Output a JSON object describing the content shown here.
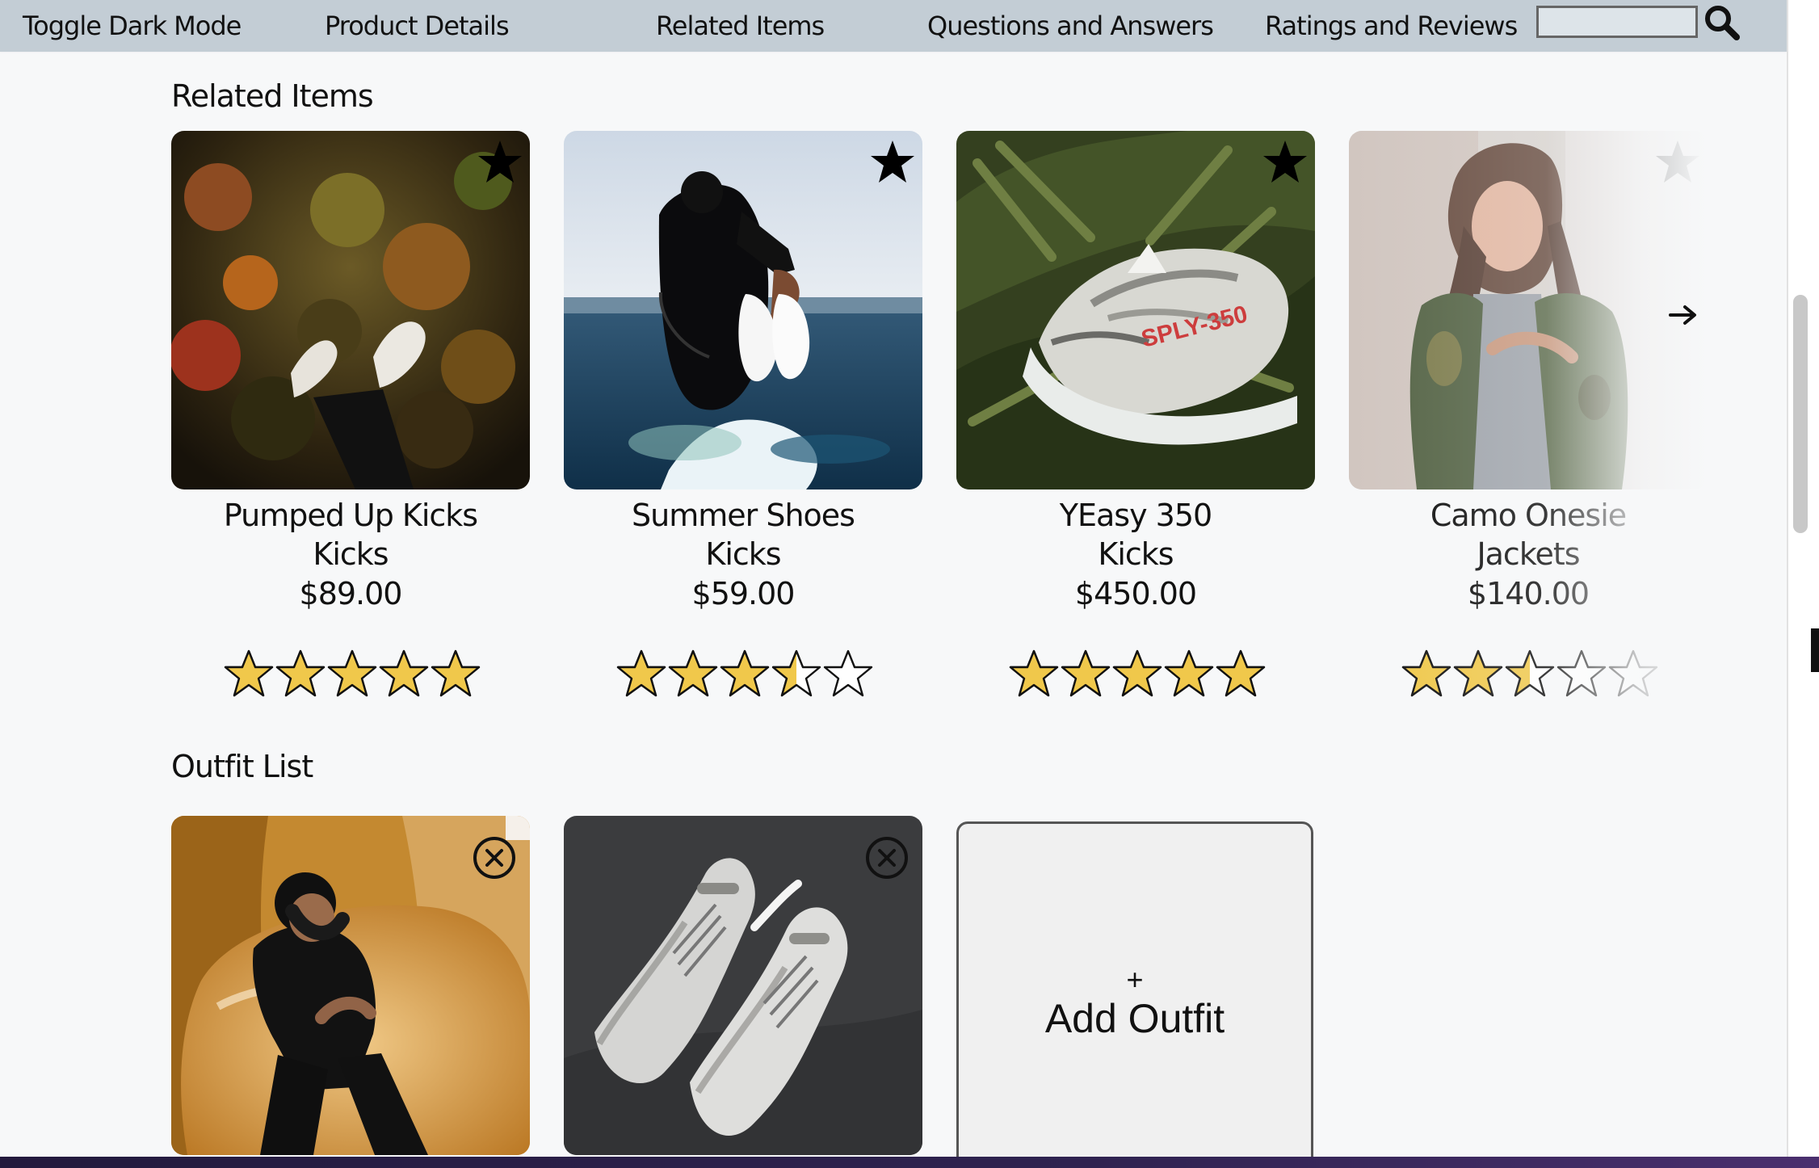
{
  "colors": {
    "navbar_bg": "#c3cdd5",
    "page_bg": "#f7f8f9",
    "star_fill": "#f0c84b",
    "text": "#111111",
    "bottom_bar": "#2f2350"
  },
  "navbar": {
    "items": [
      "Toggle Dark Mode",
      "Product Details",
      "Related Items",
      "Questions and Answers",
      "Ratings and Reviews"
    ],
    "search": {
      "value": "",
      "icon": "search-icon"
    }
  },
  "related": {
    "title": "Related Items",
    "next_icon": "arrow-right-icon",
    "items": [
      {
        "name": "Pumped Up Kicks",
        "category": "Kicks",
        "price": "$89.00",
        "rating": 5,
        "image": "sneakers-in-autumn-forest-photo",
        "action_icon": "star-icon"
      },
      {
        "name": "Summer Shoes",
        "category": "Kicks",
        "price": "$59.00",
        "rating": 3.5,
        "image": "person-in-water-holding-shoes-photo",
        "action_icon": "star-icon"
      },
      {
        "name": "YEasy 350",
        "category": "Kicks",
        "price": "$450.00",
        "rating": 5,
        "image": "sneaker-on-fern-leaves-photo",
        "action_icon": "star-icon"
      },
      {
        "name": "Camo Onesie",
        "category": "Jackets",
        "price": "$140.00",
        "rating": 2.5,
        "image": "woman-in-camo-jacket-photo",
        "action_icon": "star-icon"
      }
    ]
  },
  "outfit": {
    "title": "Outfit List",
    "items": [
      {
        "image": "person-on-fur-chair-photo",
        "action_icon": "close-icon"
      },
      {
        "image": "white-sneakers-photo",
        "action_icon": "close-icon"
      }
    ],
    "add": {
      "plus": "+",
      "label": "Add Outfit"
    }
  }
}
